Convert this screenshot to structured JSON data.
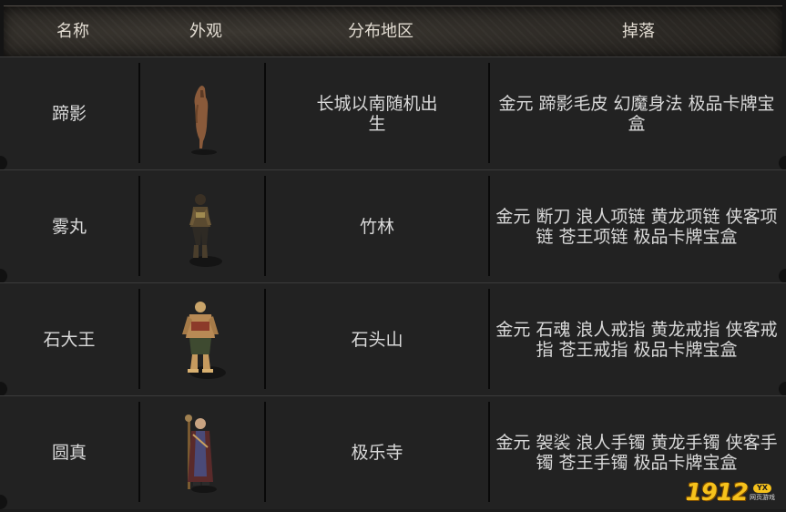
{
  "header": {
    "col_name": "名称",
    "col_look": "外观",
    "col_area": "分布地区",
    "col_drop": "掉落"
  },
  "rows": [
    {
      "name": "蹄影",
      "look_icon": "brown-horse-figure",
      "area": "长城以南随机出生",
      "drop": "金元 蹄影毛皮 幻魔身法 极品卡牌宝盒"
    },
    {
      "name": "雾丸",
      "look_icon": "armored-ninja-figure",
      "area": "竹林",
      "drop": "金元 断刀 浪人项链 黄龙项链 侠客项链 苍王项链 极品卡牌宝盒"
    },
    {
      "name": "石大王",
      "look_icon": "stone-king-warrior-figure",
      "area": "石头山",
      "drop": "金元 石魂 浪人戒指 黄龙戒指 侠客戒指 苍王戒指 极品卡牌宝盒"
    },
    {
      "name": "圆真",
      "look_icon": "robed-monk-figure",
      "area": "极乐寺",
      "drop": "金元 袈裟 浪人手镯 黄龙手镯 侠客手镯 苍王手镯 极品卡牌宝盒"
    }
  ],
  "watermark": {
    "number": "1912",
    "badge": "YX",
    "subtitle": "网页游戏"
  },
  "colors": {
    "header_text": "#e2dcd2",
    "cell_text": "#d9d9d9",
    "row_bg": "#222222",
    "logo_yellow": "#f6c21c"
  }
}
